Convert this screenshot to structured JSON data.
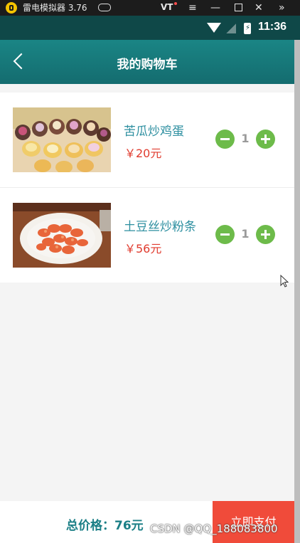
{
  "emulator": {
    "title": "雷电模拟器 3.76",
    "vt_label": "VT",
    "controls": [
      "≡",
      "—",
      "✕",
      "»"
    ]
  },
  "status_bar": {
    "time": "11:36",
    "battery_icon": "battery-charging-icon"
  },
  "header": {
    "title": "我的购物车",
    "back_icon": "chevron-left-icon"
  },
  "cart": {
    "items": [
      {
        "name": "苦瓜炒鸡蛋",
        "price": "￥20元",
        "quantity": "1",
        "image": "dessert-cups-photo"
      },
      {
        "name": "土豆丝炒粉条",
        "price": "￥56元",
        "quantity": "1",
        "image": "shrimp-plate-photo"
      }
    ]
  },
  "footer": {
    "total": "总价格：76元",
    "pay_button": "立即支付"
  },
  "watermark": "CSDN @QQ_188083800",
  "colors": {
    "header": "#167a7c",
    "accent_green": "#6dbb4a",
    "price_red": "#e03b2e",
    "pay_red": "#f04b3a"
  }
}
